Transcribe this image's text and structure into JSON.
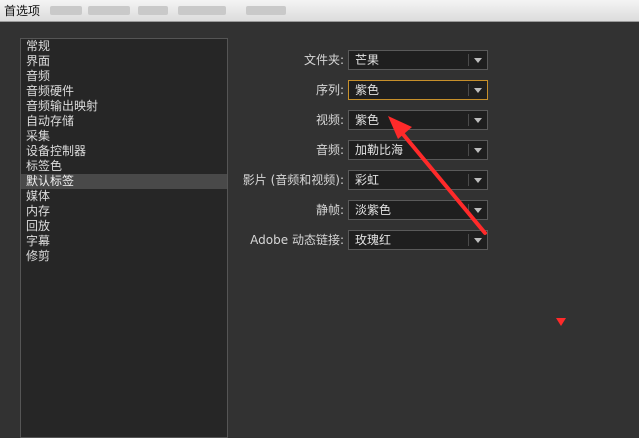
{
  "window": {
    "title": "首选项"
  },
  "sidebar": {
    "items": [
      {
        "label": "常规"
      },
      {
        "label": "界面"
      },
      {
        "label": "音频"
      },
      {
        "label": "音频硬件"
      },
      {
        "label": "音频输出映射"
      },
      {
        "label": "自动存储"
      },
      {
        "label": "采集"
      },
      {
        "label": "设备控制器"
      },
      {
        "label": "标签色"
      },
      {
        "label": "默认标签",
        "selected": true
      },
      {
        "label": "媒体"
      },
      {
        "label": "内存"
      },
      {
        "label": "回放"
      },
      {
        "label": "字幕"
      },
      {
        "label": "修剪"
      }
    ]
  },
  "settings": {
    "folder": {
      "label": "文件夹:",
      "value": "芒果"
    },
    "sequence": {
      "label": "序列:",
      "value": "紫色"
    },
    "video": {
      "label": "视频:",
      "value": "紫色"
    },
    "audio": {
      "label": "音频:",
      "value": "加勒比海"
    },
    "movie": {
      "label": "影片 (音频和视频):",
      "value": "彩虹"
    },
    "still": {
      "label": "静帧:",
      "value": "淡紫色"
    },
    "dynamic_link": {
      "label": "Adobe 动态链接:",
      "value": "玫瑰红"
    }
  },
  "colors": {
    "background": "#323232",
    "focus_border": "#c7902b",
    "annotation_red": "#ff2a2a"
  }
}
